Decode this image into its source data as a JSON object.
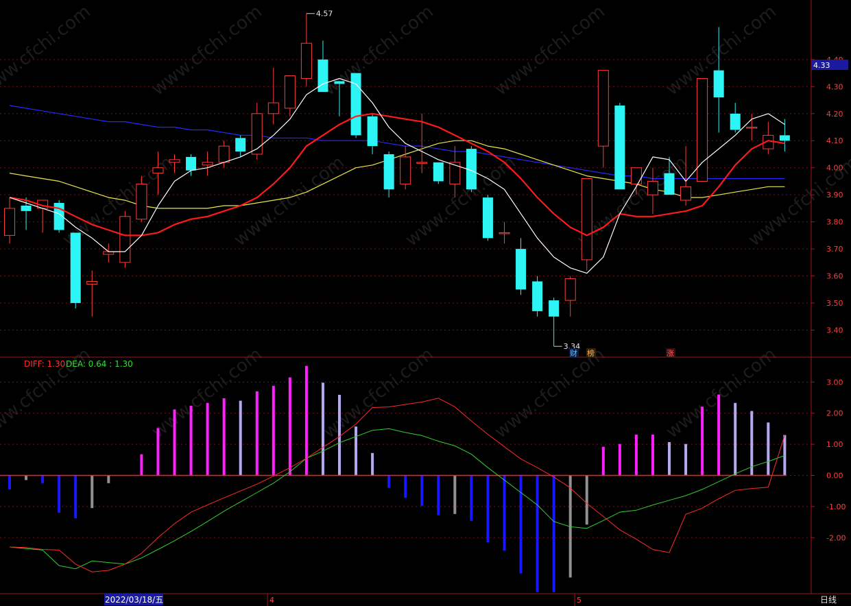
{
  "chart_data": {
    "type": "candlestick",
    "candles": [
      {
        "o": 3.75,
        "h": 3.89,
        "l": 3.72,
        "c": 3.85
      },
      {
        "o": 3.86,
        "h": 3.89,
        "l": 3.77,
        "c": 3.84
      },
      {
        "o": 3.85,
        "h": 3.88,
        "l": 3.76,
        "c": 3.88
      },
      {
        "o": 3.87,
        "h": 3.88,
        "l": 3.76,
        "c": 3.77
      },
      {
        "o": 3.76,
        "h": 3.76,
        "l": 3.48,
        "c": 3.5
      },
      {
        "o": 3.57,
        "h": 3.62,
        "l": 3.45,
        "c": 3.58
      },
      {
        "o": 3.68,
        "h": 3.72,
        "l": 3.65,
        "c": 3.69
      },
      {
        "o": 3.65,
        "h": 3.84,
        "l": 3.63,
        "c": 3.82
      },
      {
        "o": 3.81,
        "h": 3.97,
        "l": 3.8,
        "c": 3.94
      },
      {
        "o": 3.98,
        "h": 4.06,
        "l": 3.9,
        "c": 4.0
      },
      {
        "o": 4.02,
        "h": 4.05,
        "l": 3.98,
        "c": 4.03
      },
      {
        "o": 4.04,
        "h": 4.05,
        "l": 3.97,
        "c": 3.99
      },
      {
        "o": 4.01,
        "h": 4.06,
        "l": 3.97,
        "c": 4.02
      },
      {
        "o": 4.02,
        "h": 4.1,
        "l": 4.0,
        "c": 4.08
      },
      {
        "o": 4.11,
        "h": 4.12,
        "l": 4.04,
        "c": 4.06
      },
      {
        "o": 4.05,
        "h": 4.24,
        "l": 4.03,
        "c": 4.2
      },
      {
        "o": 4.2,
        "h": 4.37,
        "l": 4.16,
        "c": 4.24
      },
      {
        "o": 4.22,
        "h": 4.34,
        "l": 4.19,
        "c": 4.34
      },
      {
        "o": 4.33,
        "h": 4.57,
        "l": 4.3,
        "c": 4.46
      },
      {
        "o": 4.4,
        "h": 4.47,
        "l": 4.28,
        "c": 4.28
      },
      {
        "o": 4.32,
        "h": 4.32,
        "l": 4.19,
        "c": 4.31
      },
      {
        "o": 4.35,
        "h": 4.35,
        "l": 4.11,
        "c": 4.12
      },
      {
        "o": 4.19,
        "h": 4.2,
        "l": 4.05,
        "c": 4.08
      },
      {
        "o": 4.05,
        "h": 4.06,
        "l": 3.89,
        "c": 3.92
      },
      {
        "o": 3.94,
        "h": 4.08,
        "l": 3.92,
        "c": 4.04
      },
      {
        "o": 4.02,
        "h": 4.2,
        "l": 3.98,
        "c": 4.02
      },
      {
        "o": 4.02,
        "h": 4.02,
        "l": 3.94,
        "c": 3.95
      },
      {
        "o": 3.94,
        "h": 4.08,
        "l": 3.89,
        "c": 4.02
      },
      {
        "o": 4.07,
        "h": 4.08,
        "l": 3.91,
        "c": 3.92
      },
      {
        "o": 3.89,
        "h": 3.9,
        "l": 3.73,
        "c": 3.74
      },
      {
        "o": 3.76,
        "h": 3.8,
        "l": 3.72,
        "c": 3.76
      },
      {
        "o": 3.7,
        "h": 3.74,
        "l": 3.53,
        "c": 3.55
      },
      {
        "o": 3.58,
        "h": 3.6,
        "l": 3.45,
        "c": 3.47
      },
      {
        "o": 3.51,
        "h": 3.52,
        "l": 3.34,
        "c": 3.45
      },
      {
        "o": 3.51,
        "h": 3.6,
        "l": 3.45,
        "c": 3.59
      },
      {
        "o": 3.66,
        "h": 3.96,
        "l": 3.62,
        "c": 3.96
      },
      {
        "o": 4.08,
        "h": 4.36,
        "l": 4.0,
        "c": 4.36
      },
      {
        "o": 4.23,
        "h": 4.24,
        "l": 3.92,
        "c": 3.92
      },
      {
        "o": 3.94,
        "h": 4.0,
        "l": 3.9,
        "c": 4.0
      },
      {
        "o": 3.9,
        "h": 4.0,
        "l": 3.83,
        "c": 3.95
      },
      {
        "o": 3.98,
        "h": 4.04,
        "l": 3.9,
        "c": 3.9
      },
      {
        "o": 3.88,
        "h": 4.08,
        "l": 3.86,
        "c": 3.93
      },
      {
        "o": 3.95,
        "h": 4.33,
        "l": 3.95,
        "c": 4.33
      },
      {
        "o": 4.36,
        "h": 4.52,
        "l": 4.13,
        "c": 4.26
      },
      {
        "o": 4.2,
        "h": 4.24,
        "l": 4.13,
        "c": 4.14
      },
      {
        "o": 4.15,
        "h": 4.2,
        "l": 4.1,
        "c": 4.15
      },
      {
        "o": 4.07,
        "h": 4.17,
        "l": 4.05,
        "c": 4.12
      },
      {
        "o": 4.12,
        "h": 4.18,
        "l": 4.06,
        "c": 4.1
      }
    ],
    "ma_white": [
      3.89,
      3.87,
      3.85,
      3.83,
      3.78,
      3.74,
      3.69,
      3.69,
      3.75,
      3.86,
      3.95,
      3.99,
      4.0,
      4.02,
      4.04,
      4.07,
      4.12,
      4.18,
      4.27,
      4.31,
      4.33,
      4.31,
      4.24,
      4.15,
      4.09,
      4.06,
      4.03,
      4.01,
      3.99,
      3.96,
      3.92,
      3.83,
      3.74,
      3.67,
      3.63,
      3.61,
      3.67,
      3.83,
      3.93,
      4.04,
      4.03,
      3.95,
      4.02,
      4.07,
      4.12,
      4.18,
      4.2,
      4.16
    ],
    "ma_red": [
      3.89,
      3.88,
      3.86,
      3.85,
      3.82,
      3.79,
      3.77,
      3.75,
      3.75,
      3.76,
      3.79,
      3.81,
      3.82,
      3.84,
      3.86,
      3.89,
      3.94,
      4.0,
      4.08,
      4.12,
      4.16,
      4.19,
      4.2,
      4.19,
      4.18,
      4.17,
      4.15,
      4.12,
      4.09,
      4.06,
      4.02,
      3.96,
      3.89,
      3.83,
      3.78,
      3.75,
      3.78,
      3.83,
      3.82,
      3.82,
      3.83,
      3.84,
      3.86,
      3.93,
      4.01,
      4.07,
      4.1,
      4.09
    ],
    "ma_yellow": [
      3.98,
      3.97,
      3.96,
      3.95,
      3.93,
      3.91,
      3.89,
      3.88,
      3.86,
      3.85,
      3.85,
      3.85,
      3.85,
      3.86,
      3.86,
      3.87,
      3.88,
      3.89,
      3.91,
      3.94,
      3.97,
      4.0,
      4.01,
      4.03,
      4.05,
      4.07,
      4.09,
      4.1,
      4.1,
      4.08,
      4.07,
      4.05,
      4.03,
      4.01,
      3.99,
      3.97,
      3.96,
      3.95,
      3.94,
      3.92,
      3.91,
      3.89,
      3.89,
      3.9,
      3.91,
      3.92,
      3.93,
      3.93
    ],
    "ma_blue": [
      4.23,
      4.22,
      4.21,
      4.2,
      4.19,
      4.18,
      4.17,
      4.17,
      4.16,
      4.15,
      4.15,
      4.14,
      4.14,
      4.13,
      4.12,
      4.12,
      4.11,
      4.11,
      4.11,
      4.1,
      4.1,
      4.1,
      4.1,
      4.09,
      4.08,
      4.08,
      4.07,
      4.06,
      4.06,
      4.05,
      4.04,
      4.03,
      4.02,
      4.01,
      4.0,
      3.99,
      3.98,
      3.97,
      3.97,
      3.96,
      3.96,
      3.96,
      3.96,
      3.96,
      3.96,
      3.96,
      3.96,
      3.96
    ],
    "price_range": [
      3.3,
      4.62
    ],
    "price_ticks": [
      "4.40",
      "4.30",
      "4.20",
      "4.10",
      "4.00",
      "3.90",
      "3.80",
      "3.70",
      "3.60",
      "3.50",
      "3.40"
    ],
    "high_label": "4.57",
    "low_label": "3.34",
    "last_price_label": "4.33",
    "macd_range": [
      -3.8,
      3.8
    ],
    "macd_ticks": [
      "3.00",
      "2.00",
      "1.00",
      "0.00",
      "-1.00",
      "-2.00"
    ],
    "macd_hist": [
      -0.45,
      -0.15,
      -0.25,
      -1.2,
      -1.38,
      -1.05,
      -0.25,
      0,
      0.68,
      1.52,
      2.12,
      2.24,
      2.33,
      2.48,
      2.4,
      2.7,
      2.88,
      3.15,
      3.52,
      2.98,
      2.59,
      1.57,
      0.72,
      -0.4,
      -0.72,
      -0.98,
      -1.28,
      -1.24,
      -1.46,
      -2.15,
      -2.42,
      -3.15,
      -3.75,
      -3.75,
      -3.28,
      -1.58,
      0.92,
      1.01,
      1.31,
      1.31,
      1.07,
      1.01,
      2.21,
      2.6,
      2.33,
      2.07,
      1.7,
      1.3
    ],
    "macd_diff": [
      -2.3,
      -2.32,
      -2.38,
      -2.4,
      -2.85,
      -3.1,
      -3.05,
      -2.85,
      -2.5,
      -2.0,
      -1.55,
      -1.18,
      -0.95,
      -0.72,
      -0.5,
      -0.28,
      -0.02,
      0.25,
      0.55,
      0.9,
      1.25,
      1.65,
      2.18,
      2.2,
      2.28,
      2.36,
      2.48,
      2.2,
      1.75,
      1.32,
      0.92,
      0.53,
      0.25,
      -0.05,
      -0.4,
      -0.9,
      -1.32,
      -1.75,
      -2.05,
      -2.38,
      -2.48,
      -1.25,
      -1.05,
      -0.75,
      -0.48,
      -0.42,
      -0.38,
      1.3
    ],
    "macd_dea": [
      -2.3,
      -2.35,
      -2.4,
      -2.9,
      -3.0,
      -2.75,
      -2.8,
      -2.85,
      -2.65,
      -2.38,
      -2.1,
      -1.8,
      -1.48,
      -1.15,
      -0.85,
      -0.55,
      -0.25,
      0.12,
      0.55,
      0.78,
      1.05,
      1.25,
      1.45,
      1.5,
      1.38,
      1.28,
      1.1,
      0.95,
      0.68,
      0.25,
      -0.15,
      -0.55,
      -0.95,
      -1.48,
      -1.65,
      -1.7,
      -1.45,
      -1.18,
      -1.12,
      -0.95,
      -0.8,
      -0.65,
      -0.45,
      -0.2,
      0.05,
      0.28,
      0.45,
      0.64
    ],
    "macd_label_diff": "DIFF: 1.30",
    "macd_label_dea": "DEA: 0.64 : 1.30",
    "date_label": "2022/03/18/五",
    "month_markers": [
      "4",
      "5"
    ],
    "period_label": "日线",
    "event_badges": [
      "财",
      "榜",
      "涨"
    ],
    "watermark_text": "www.cfchi.com",
    "colors": {
      "up": "#ff3c3c",
      "down": "#2ef5f5",
      "ma_white": "#ffffff",
      "ma_red": "#ff1a1a",
      "ma_yellow": "#e8e84a",
      "ma_blue": "#2828ff",
      "hist_pos": "#ff20ff",
      "hist_pos_weak": "#b4a8f0",
      "hist_neg": "#1818ff",
      "hist_neg_weak": "#909090",
      "diff": "#ff2a2a",
      "dea": "#30d030",
      "grid": "#7a1010",
      "axis_text": "#ff4040",
      "price_box": "#1a1aa0"
    }
  }
}
